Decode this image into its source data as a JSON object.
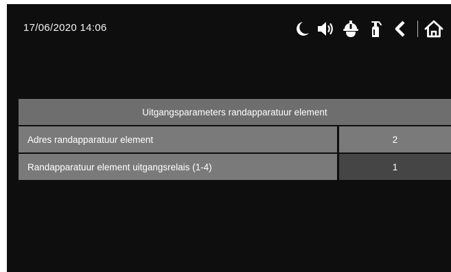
{
  "status_bar": {
    "datetime": "17/06/2020  14:06",
    "icons": [
      "moon-icon",
      "speaker-icon",
      "helmet-icon",
      "fire-extinguisher-icon",
      "back-icon",
      "home-icon"
    ]
  },
  "panel": {
    "title": "Uitgangsparameters randapparatuur element",
    "rows": [
      {
        "label": "Adres randapparatuur element",
        "value": "2"
      },
      {
        "label": "Randapparatuur element uitgangsrelais (1-4)",
        "value": "1"
      }
    ]
  },
  "colors": {
    "background": "#0e0e0e",
    "header": "#6e6e6e",
    "row": "#7a7a7a",
    "value_selected": "#454545",
    "text": "#ffffff"
  }
}
